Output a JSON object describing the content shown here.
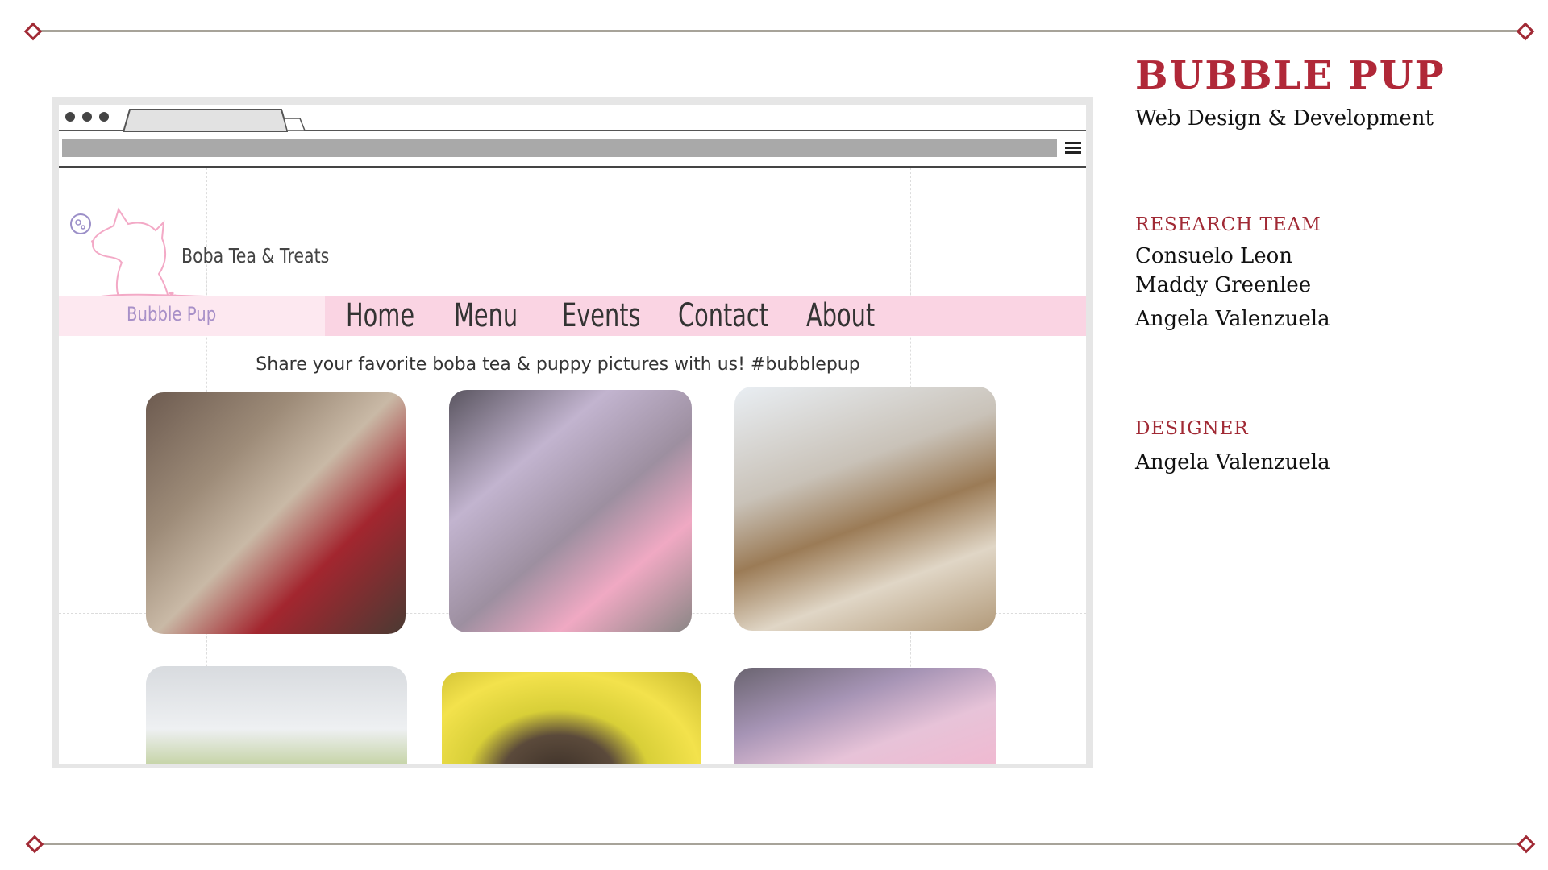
{
  "slide": {
    "title": "BUBBLE PUP",
    "subtitle": "Web Design & Development",
    "research_team": {
      "heading": "RESEARCH TEAM",
      "members": [
        "Consuelo Leon",
        "Maddy Greenlee",
        "Angela Valenzuela"
      ]
    },
    "designer": {
      "heading": "DESIGNER",
      "name": "Angela Valenzuela"
    },
    "colors": {
      "accent": "#a12a35",
      "rule": "#a7a399",
      "nav_pink": "#fad4e3"
    }
  },
  "browser": {
    "menu_icon": "hamburger-icon"
  },
  "site": {
    "logo": {
      "name": "Boba Tea & Treats",
      "sub": "Bubble Pup"
    },
    "nav": [
      "Home",
      "Menu",
      "Events",
      "Contact",
      "About"
    ],
    "tagline": "Share your favorite boba tea & puppy pictures with us! #bubblepup",
    "photos": [
      "pink-boba-tea-and-yorkie-photo",
      "two-boba-teas-toast-photo",
      "people-with-dogs-photo",
      "boba-cups-photo",
      "sleeping-dog-photo",
      "pink-drink-heart-photo"
    ]
  }
}
